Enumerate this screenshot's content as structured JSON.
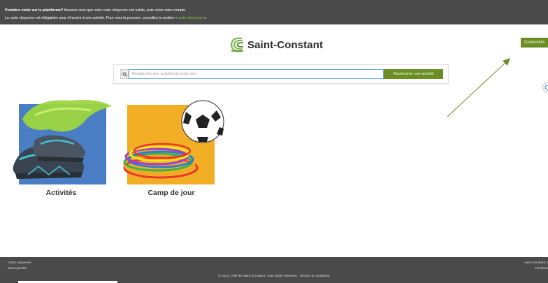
{
  "topbar": {
    "line1_bold": "Première visite sur la plateforme?",
    "line1_rest": " Assurez-vous que votre carte citoyenne soit valide, puis créez votre compte.",
    "line2_start": "La carte citoyenne est obligatoire pour s'inscrire à une activité. Pour vous la procurer, consultez la section « ",
    "line2_link": "carte citoyenne",
    "line2_end": " »."
  },
  "header": {
    "logo_text": "Saint-Constant",
    "login_label": "Connexion"
  },
  "search": {
    "placeholder": "Rechercher une activité par mots clés",
    "button_label": "Rechercher une activité"
  },
  "tiles": [
    {
      "label": "Activités"
    },
    {
      "label": "Camp de jour"
    }
  ],
  "footer": {
    "link1": "Carte citoyenne",
    "link2": "Nous joindre",
    "copyright": "© 2021, Ville de Saint-Constant. Tous droits réservés.",
    "terms": "Termes & conditions",
    "right1": "saint-constant.c",
    "right2": "Faceboo"
  },
  "colors": {
    "accent_green": "#6b8e23",
    "topbar_bg": "#4a4a4a",
    "arrow": "#6b8e23"
  }
}
